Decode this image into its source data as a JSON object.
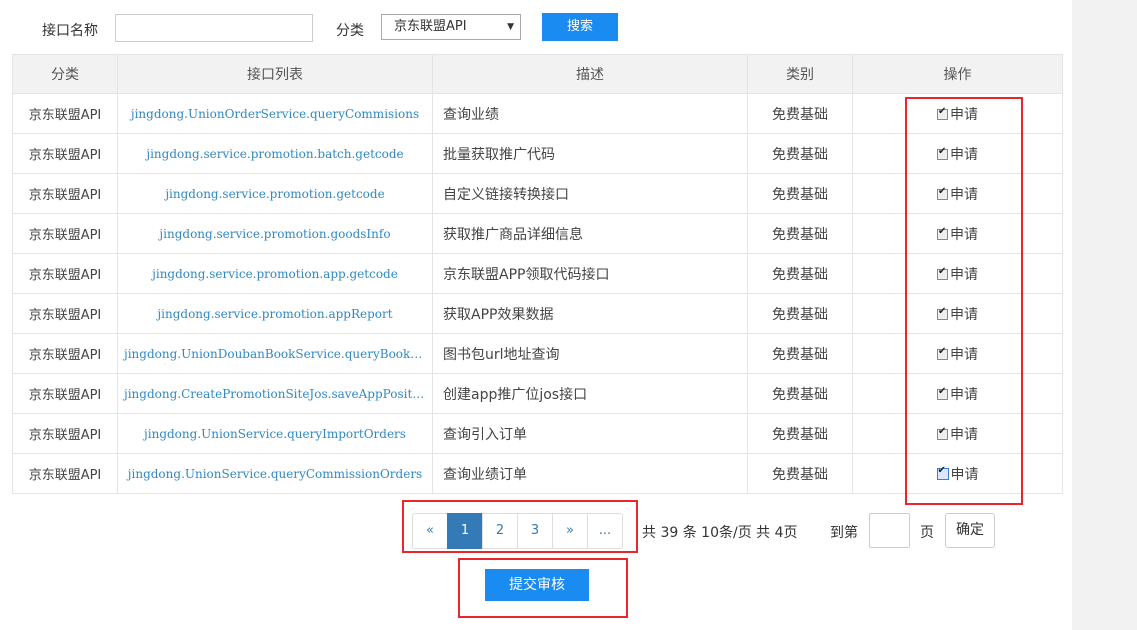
{
  "search": {
    "name_label": "接口名称",
    "name_value": "",
    "category_label": "分类",
    "category_selected": "京东联盟API",
    "search_button": "搜索"
  },
  "table": {
    "headers": [
      "分类",
      "接口列表",
      "描述",
      "类别",
      "操作"
    ],
    "rows": [
      {
        "category": "京东联盟API",
        "api": "jingdong.UnionOrderService.queryCommisions",
        "desc": "查询业绩",
        "type": "免费基础",
        "action": "申请",
        "checked": true
      },
      {
        "category": "京东联盟API",
        "api": "jingdong.service.promotion.batch.getcode",
        "desc": "批量获取推广代码",
        "type": "免费基础",
        "action": "申请",
        "checked": true
      },
      {
        "category": "京东联盟API",
        "api": "jingdong.service.promotion.getcode",
        "desc": "自定义链接转换接口",
        "type": "免费基础",
        "action": "申请",
        "checked": true
      },
      {
        "category": "京东联盟API",
        "api": "jingdong.service.promotion.goodsInfo",
        "desc": "获取推广商品详细信息",
        "type": "免费基础",
        "action": "申请",
        "checked": true
      },
      {
        "category": "京东联盟API",
        "api": "jingdong.service.promotion.app.getcode",
        "desc": "京东联盟APP领取代码接口",
        "type": "免费基础",
        "action": "申请",
        "checked": true
      },
      {
        "category": "京东联盟API",
        "api": "jingdong.service.promotion.appReport",
        "desc": "获取APP效果数据",
        "type": "免费基础",
        "action": "申请",
        "checked": true
      },
      {
        "category": "京东联盟API",
        "api": "jingdong.UnionDoubanBookService.queryBookUrl",
        "desc": "图书包url地址查询",
        "type": "免费基础",
        "action": "申请",
        "checked": true
      },
      {
        "category": "京东联盟API",
        "api": "jingdong.CreatePromotionSiteJos.saveAppPosition",
        "desc": "创建app推广位jos接口",
        "type": "免费基础",
        "action": "申请",
        "checked": true
      },
      {
        "category": "京东联盟API",
        "api": "jingdong.UnionService.queryImportOrders",
        "desc": "查询引入订单",
        "type": "免费基础",
        "action": "申请",
        "checked": true
      },
      {
        "category": "京东联盟API",
        "api": "jingdong.UnionService.queryCommissionOrders",
        "desc": "查询业绩订单",
        "type": "免费基础",
        "action": "申请",
        "checked": true
      }
    ]
  },
  "pagination": {
    "prev": "«",
    "pages": [
      "1",
      "2",
      "3"
    ],
    "active_page": "1",
    "next": "»",
    "more": "...",
    "total_text": "共 39 条 10条/页 共 4页",
    "goto_label": "到第",
    "page_value": "",
    "page_unit": "页",
    "confirm": "确定"
  },
  "submit_label": "提交审核",
  "colors": {
    "primary": "#1a8bf0",
    "link": "#2f89c5",
    "active_page": "#337ab7",
    "highlight": "#e8262c"
  }
}
